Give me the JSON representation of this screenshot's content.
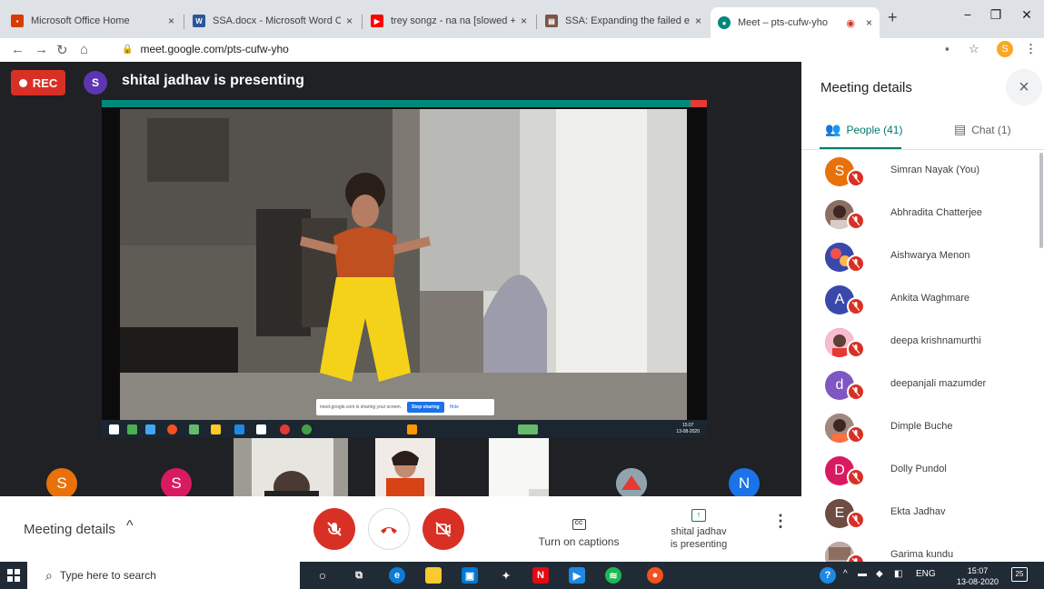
{
  "browser": {
    "tabs": [
      {
        "title": "Microsoft Office Home",
        "favicon_color": "#d83b01",
        "active": false
      },
      {
        "title": "SSA.docx - Microsoft Word On",
        "favicon_color": "#2b579a",
        "active": false
      },
      {
        "title": "trey songz - na na [slowed + re",
        "favicon_color": "#ff0000",
        "active": false
      },
      {
        "title": "SSA: Expanding the failed educ",
        "favicon_color": "#795548",
        "active": false
      },
      {
        "title": "Meet – pts-cufw-yho",
        "favicon_color": "#00897b",
        "active": true
      }
    ],
    "tab_close_glyph": "×",
    "new_tab_glyph": "+",
    "window_controls": {
      "minimize": "−",
      "restore": "❐",
      "close": "✕"
    },
    "url": "meet.google.com/pts-cufw-yho",
    "profile_initial": "S"
  },
  "meeting": {
    "rec_label": "REC",
    "presenter_initial": "S",
    "presenter_text": "shital jadhav is presenting",
    "share_notice": "meet.google.com is sharing your screen.",
    "stop_sharing": "Stop sharing",
    "hide": "Hide",
    "inner_clock_time": "15:07",
    "inner_clock_date": "13-08-2020",
    "filmstrip": [
      {
        "initial": "S",
        "color": "#e8710a"
      },
      {
        "initial": "S",
        "color": "#d81b60"
      },
      {
        "initial": "N",
        "color": "#1a73e8"
      }
    ]
  },
  "bottom_bar": {
    "meeting_details": "Meeting details",
    "chevron": "^",
    "captions_label": "Turn on captions",
    "captions_icon": "CC",
    "present_line1": "shital jadhav",
    "present_line2": "is presenting",
    "more_glyph": "⋮"
  },
  "panel": {
    "title": "Meeting details",
    "close_glyph": "×",
    "people_tab": "People (41)",
    "chat_tab": "Chat (1)",
    "people": [
      {
        "name": "Simran Nayak (You)",
        "initial": "S",
        "color": "#e8710a"
      },
      {
        "name": "Abhradita Chatterjee",
        "initial": "",
        "color": "#8d6e63"
      },
      {
        "name": "Aishwarya Menon",
        "initial": "",
        "color": "#5c6bc0"
      },
      {
        "name": "Ankita Waghmare",
        "initial": "A",
        "color": "#3949ab"
      },
      {
        "name": "deepa krishnamurthi",
        "initial": "",
        "color": "#c2185b"
      },
      {
        "name": "deepanjali mazumder",
        "initial": "d",
        "color": "#7e57c2"
      },
      {
        "name": "Dimple Buche",
        "initial": "",
        "color": "#6d4c41"
      },
      {
        "name": "Dolly Pundol",
        "initial": "D",
        "color": "#d81b60"
      },
      {
        "name": "Ekta Jadhav",
        "initial": "E",
        "color": "#6d4c41"
      },
      {
        "name": "Garima kundu",
        "initial": "",
        "color": "#a1887f"
      }
    ]
  },
  "taskbar": {
    "search_placeholder": "Type here to search",
    "lang": "ENG",
    "time": "15:07",
    "date": "13-08-2020",
    "notifications": "25"
  }
}
